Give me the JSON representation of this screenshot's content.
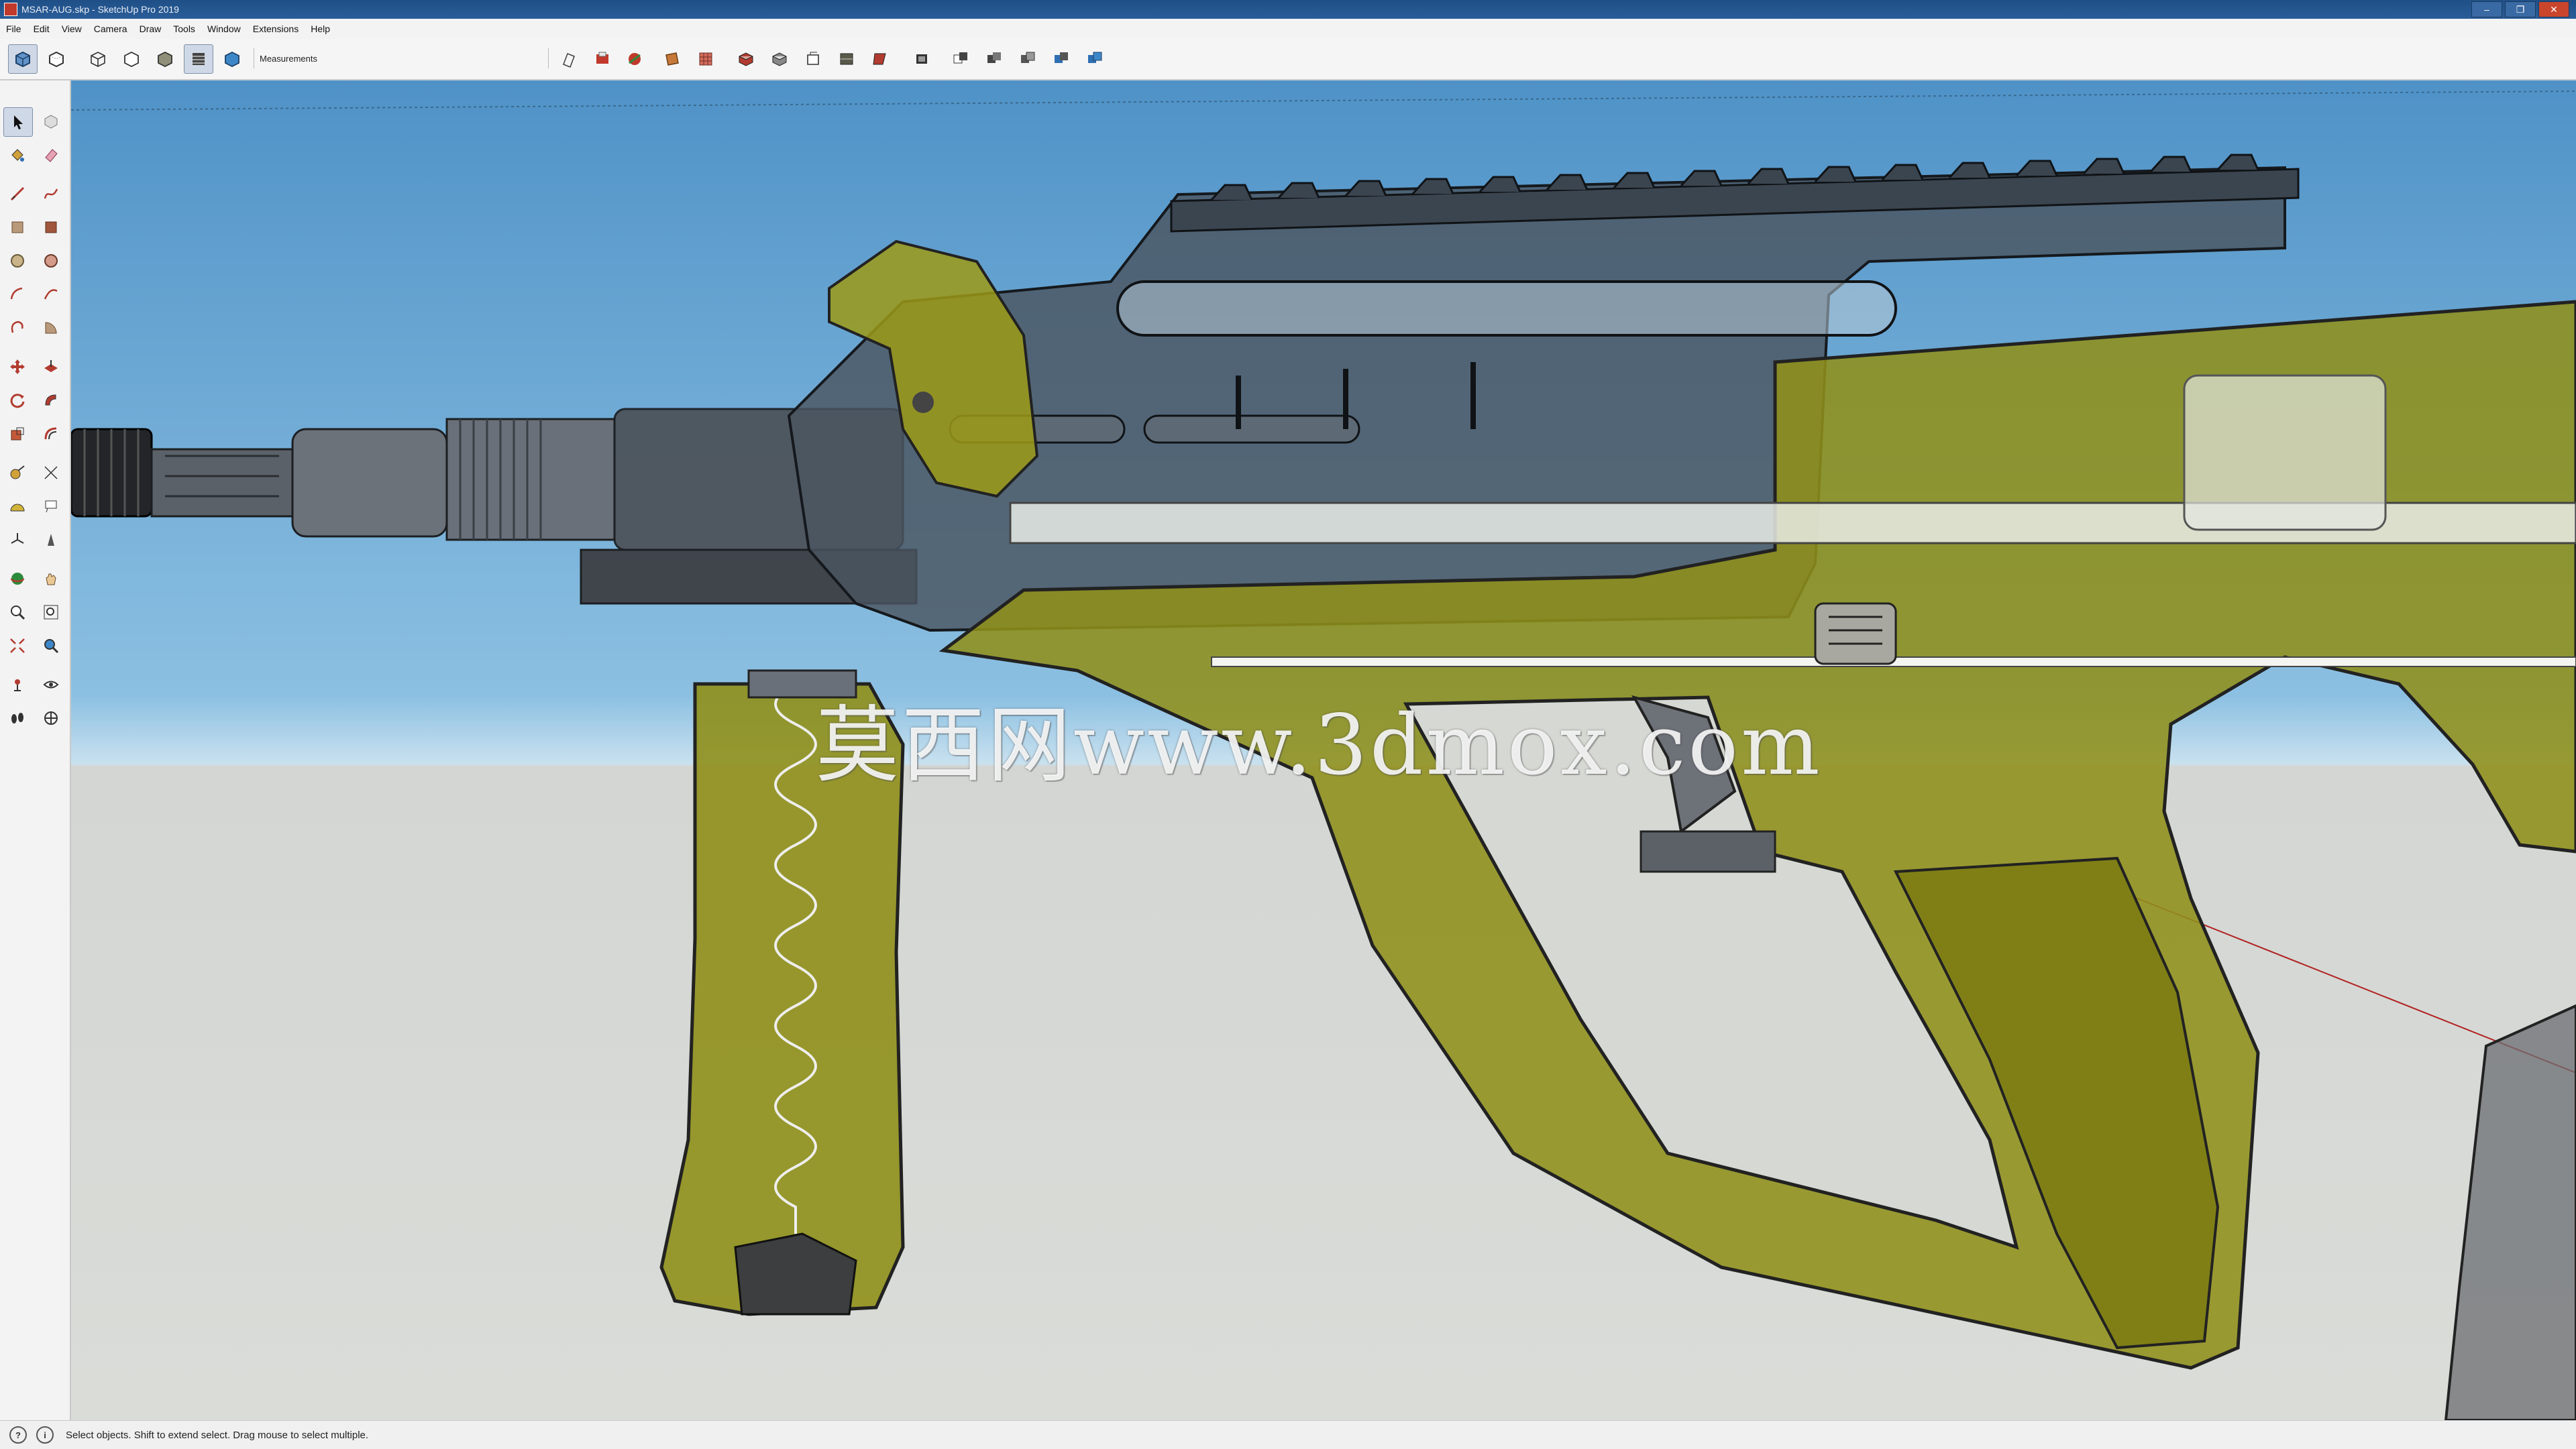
{
  "window": {
    "title": "MSAR-AUG.skp - SketchUp Pro 2019",
    "controls": [
      "minimize-icon",
      "restore-icon",
      "close-icon"
    ]
  },
  "menu": {
    "items": [
      "File",
      "Edit",
      "View",
      "Camera",
      "Draw",
      "Tools",
      "Window",
      "Extensions",
      "Help"
    ]
  },
  "toolbar": {
    "measurements_label": "Measurements",
    "style_buttons": [
      "xray-icon",
      "back-edges-icon",
      "wireframe-icon",
      "hidden-line-icon",
      "shaded-icon",
      "shaded-textures-icon",
      "monochrome-icon"
    ],
    "view_buttons": [
      "section-plane-icon",
      "section-fill-icon",
      "section-cut-icon",
      "section-display-icon",
      "iso-view-icon",
      "top-view-icon",
      "front-view-icon",
      "right-view-icon",
      "back-view-icon",
      "left-view-icon",
      "bottom-view-icon",
      "component-icon",
      "outliner-icon",
      "layers-icon",
      "materials-icon"
    ],
    "active": [
      "xray-icon",
      "shaded-icon"
    ]
  },
  "palette": {
    "tools": [
      "select-icon",
      "make-component-icon",
      "paint-bucket-icon",
      "eraser-icon",
      "line-icon",
      "freehand-icon",
      "rectangle-icon",
      "rotated-rectangle-icon",
      "circle-icon",
      "polygon-icon",
      "arc-icon",
      "two-point-arc-icon",
      "three-point-arc-icon",
      "pie-icon",
      "move-icon",
      "push-pull-icon",
      "rotate-icon",
      "follow-me-icon",
      "scale-icon",
      "offset-icon",
      "tape-measure-icon",
      "dimension-icon",
      "protractor-icon",
      "text-icon",
      "axes-icon",
      "3d-text-icon",
      "orbit-icon",
      "pan-icon",
      "zoom-icon",
      "zoom-window-icon",
      "zoom-extents-icon",
      "previous-view-icon",
      "position-camera-icon",
      "look-around-icon",
      "walk-icon",
      "section-plane-tool-icon"
    ],
    "active": "select-icon"
  },
  "viewport": {
    "watermark": "莫西网www.3dmox.com",
    "model_colors": {
      "olive": "#8f8f1a",
      "olive_dark": "#5e5d10",
      "steel": "#4a5a66",
      "sky_top": "#4f92c7",
      "ground": "#d8dad7"
    }
  },
  "status": {
    "text": "Select objects. Shift to extend select. Drag mouse to select multiple."
  }
}
